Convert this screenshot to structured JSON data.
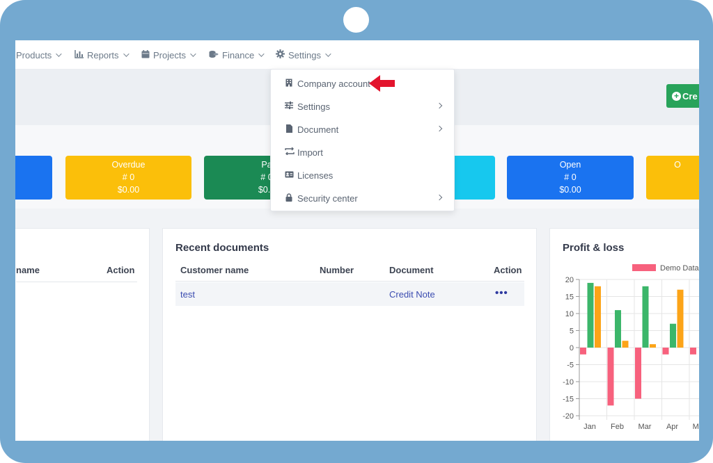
{
  "nav": {
    "items": [
      {
        "label": "Products",
        "icon": "products-icon"
      },
      {
        "label": "Reports",
        "icon": "bar-chart-icon"
      },
      {
        "label": "Projects",
        "icon": "calendar-icon"
      },
      {
        "label": "Finance",
        "icon": "coins-icon"
      },
      {
        "label": "Settings",
        "icon": "gear-icon"
      }
    ]
  },
  "header": {
    "create_label": "Cre"
  },
  "stats": [
    {
      "title": "",
      "count": "",
      "amount": "",
      "color": "#1a73f0"
    },
    {
      "title": "Overdue",
      "count": "# 0",
      "amount": "$0.00",
      "color": "#fbbf0a"
    },
    {
      "title": "Pa",
      "count": "# 0",
      "amount": "$0.0",
      "color": "#1b8a54"
    },
    {
      "title": "",
      "count": "",
      "amount": "",
      "color": "#17c8ee"
    },
    {
      "title": "Open",
      "count": "# 0",
      "amount": "$0.00",
      "color": "#1a73f0"
    },
    {
      "title": "O",
      "count": "",
      "amount": "",
      "color": "#fbbf0a"
    }
  ],
  "left_panel": {
    "col_name": "name",
    "col_action": "Action"
  },
  "recent": {
    "title": "Recent documents",
    "columns": [
      "Customer name",
      "Number",
      "Document",
      "Action"
    ],
    "rows": [
      {
        "customer": "test",
        "number": "",
        "document": "Credit Note",
        "action": "•••"
      }
    ]
  },
  "dropdown": {
    "items": [
      {
        "label": "Company account",
        "icon": "building-icon",
        "submenu": false
      },
      {
        "label": "Settings",
        "icon": "sliders-icon",
        "submenu": true
      },
      {
        "label": "Document",
        "icon": "file-icon",
        "submenu": true
      },
      {
        "label": "Import",
        "icon": "swap-icon",
        "submenu": false
      },
      {
        "label": "Licenses",
        "icon": "id-card-icon",
        "submenu": false
      },
      {
        "label": "Security center",
        "icon": "lock-icon",
        "submenu": true
      }
    ]
  },
  "chart_data": {
    "type": "bar",
    "title": "Profit & loss",
    "categories": [
      "Jan",
      "Feb",
      "Mar",
      "Apr",
      "May"
    ],
    "series": [
      {
        "name": "Demo Data",
        "color": "#f7617d",
        "values": [
          -2,
          -17,
          -15,
          -2,
          -2
        ]
      },
      {
        "name": "",
        "color": "#3cb66a",
        "values": [
          19,
          11,
          18,
          7,
          0
        ]
      },
      {
        "name": "",
        "color": "#fca418",
        "values": [
          18,
          2,
          1,
          17,
          0
        ]
      }
    ],
    "ylim": [
      -20,
      20
    ],
    "yticks": [
      "20",
      "15",
      "10",
      "5",
      "0",
      "-5",
      "-10",
      "-15",
      "-20"
    ],
    "grid": true,
    "legend": "top"
  }
}
